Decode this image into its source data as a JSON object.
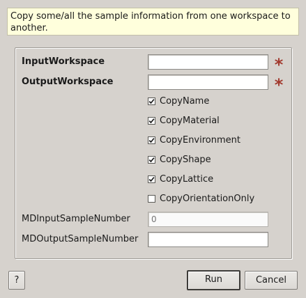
{
  "description": "Copy some/all the sample information from one workspace to another.",
  "properties": {
    "input_workspace": {
      "label": "InputWorkspace",
      "value": "",
      "required_marker": "*"
    },
    "output_workspace": {
      "label": "OutputWorkspace",
      "value": "",
      "required_marker": "*"
    },
    "checkboxes": [
      {
        "label": "CopyName",
        "checked": true
      },
      {
        "label": "CopyMaterial",
        "checked": true
      },
      {
        "label": "CopyEnvironment",
        "checked": true
      },
      {
        "label": "CopyShape",
        "checked": true
      },
      {
        "label": "CopyLattice",
        "checked": true
      },
      {
        "label": "CopyOrientationOnly",
        "checked": false
      }
    ],
    "md_input_sample_number": {
      "label": "MDInputSampleNumber",
      "placeholder": "0",
      "value": ""
    },
    "md_output_sample_number": {
      "label": "MDOutputSampleNumber",
      "value": ""
    }
  },
  "buttons": {
    "help": "?",
    "run": "Run",
    "cancel": "Cancel"
  },
  "colors": {
    "background": "#d6d2cd",
    "description_bg": "#ffffdc",
    "required_star": "#a23a2e"
  }
}
